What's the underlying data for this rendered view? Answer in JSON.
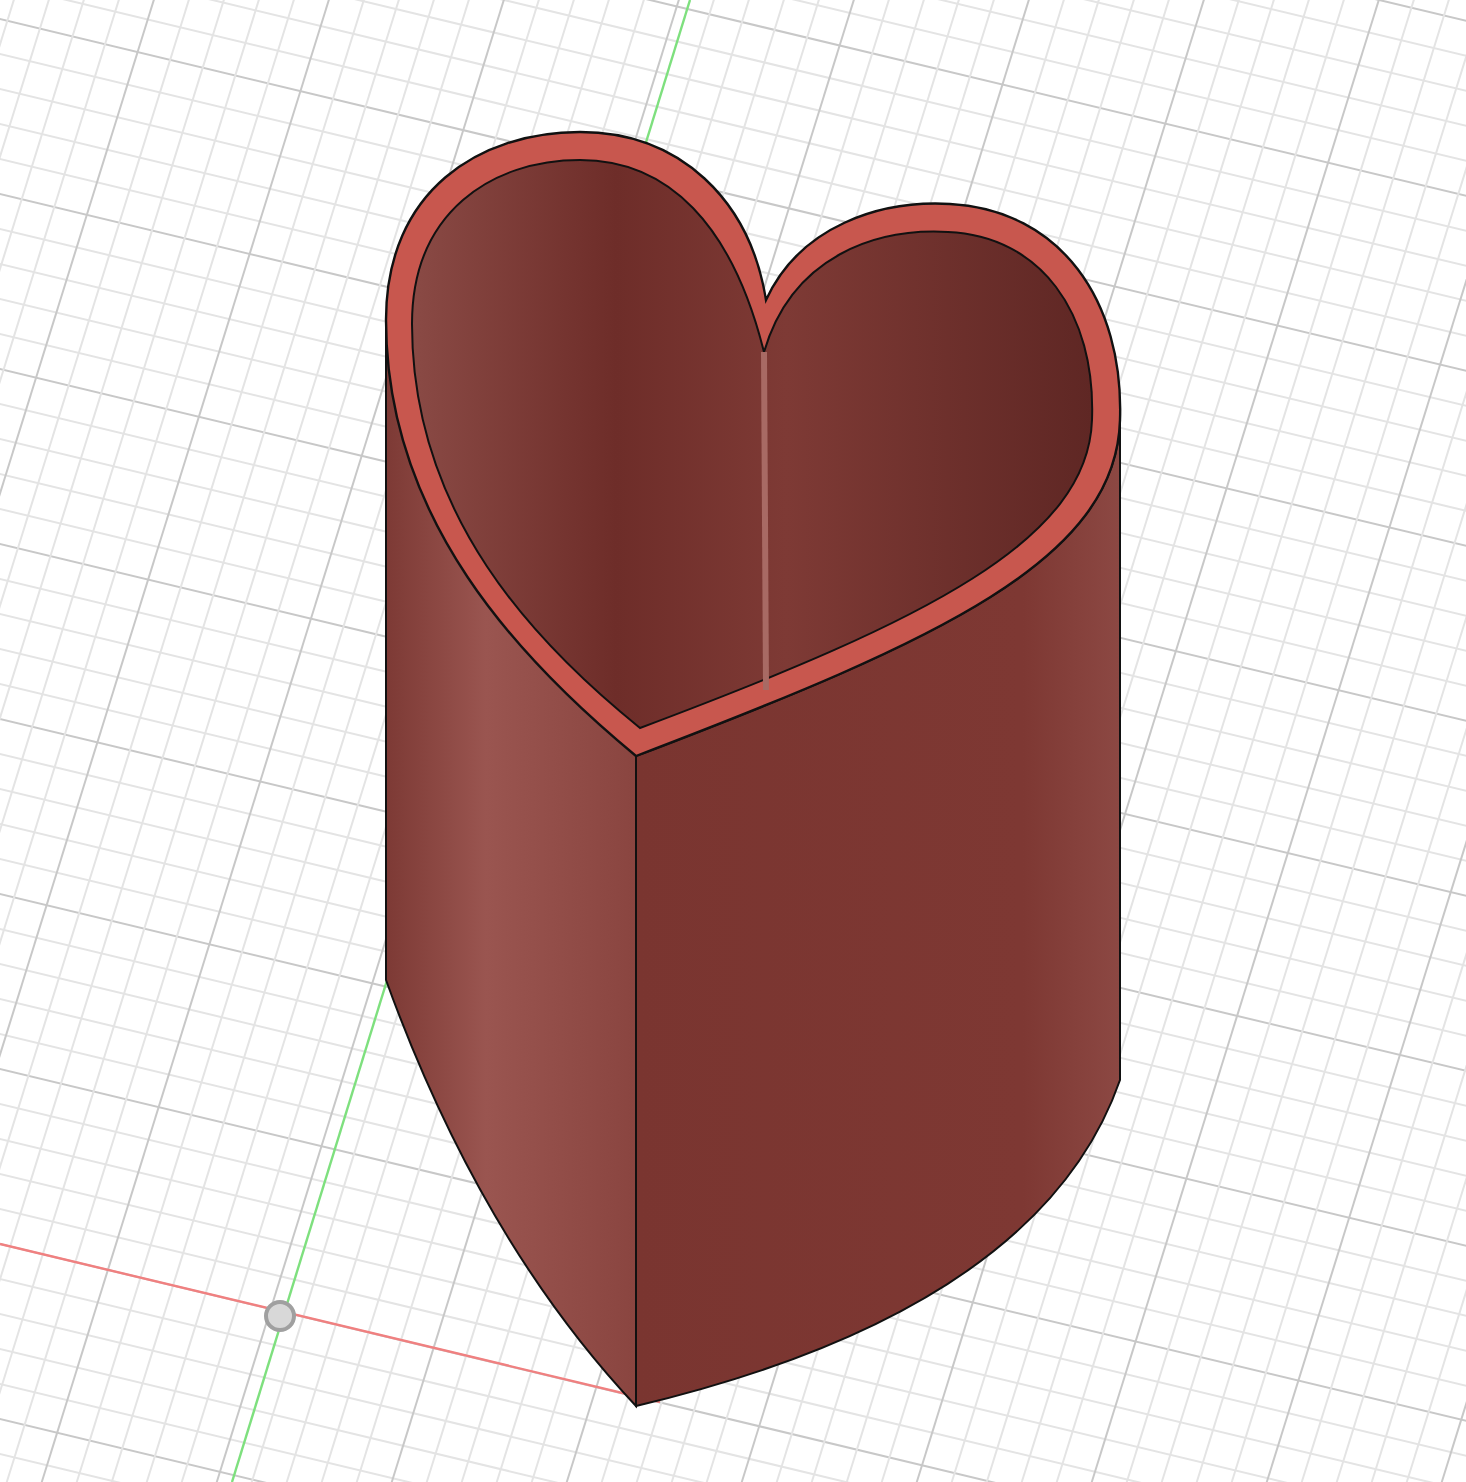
{
  "viewport": {
    "show_grid": true,
    "show_axes": true,
    "show_origin": true
  }
}
